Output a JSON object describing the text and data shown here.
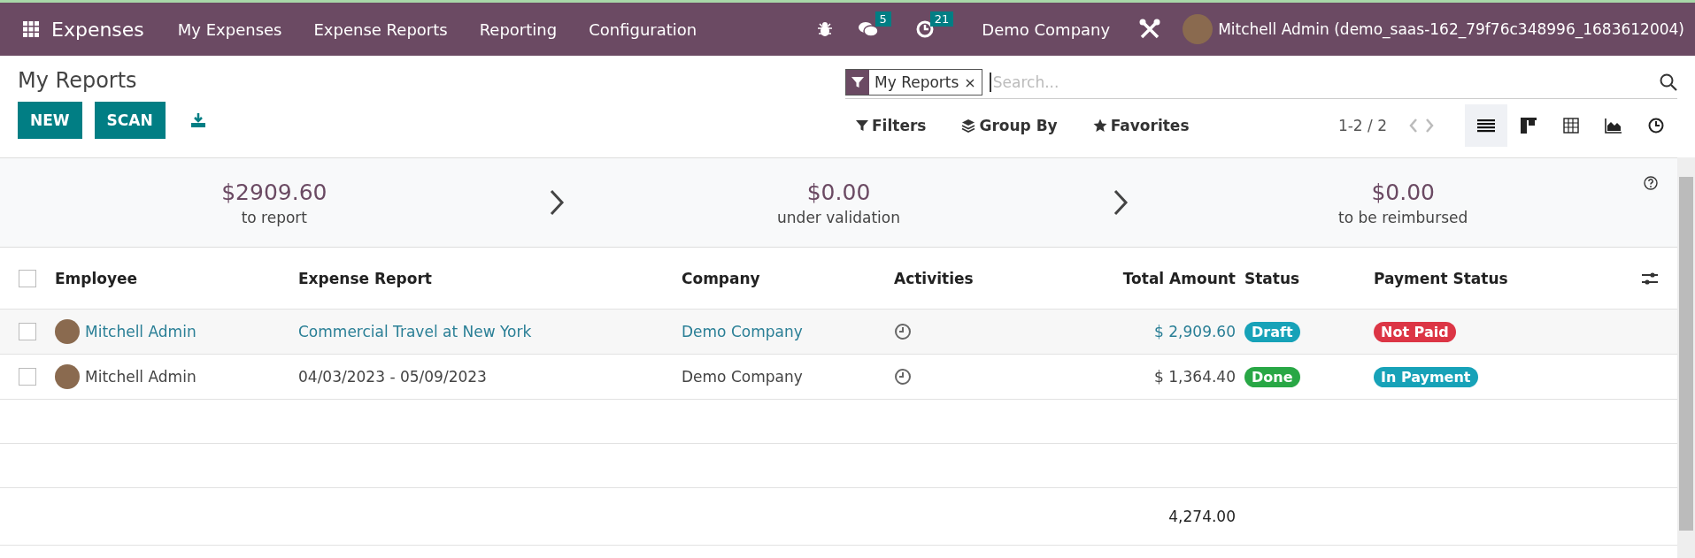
{
  "navbar": {
    "app_name": "Expenses",
    "menu": [
      "My Expenses",
      "Expense Reports",
      "Reporting",
      "Configuration"
    ],
    "messages_count": "5",
    "activities_count": "21",
    "company": "Demo Company",
    "user": "Mitchell Admin (demo_saas-162_79f76c348996_1683612004)"
  },
  "page": {
    "title": "My Reports",
    "buttons": [
      "NEW",
      "SCAN"
    ]
  },
  "search": {
    "facet": "My Reports",
    "facet_remove": "×",
    "placeholder": "Search..."
  },
  "filters": [
    "Filters",
    "Group By",
    "Favorites"
  ],
  "pager": "1-2 / 2",
  "views": [
    {
      "kind": "list",
      "selected": true
    },
    {
      "kind": "kanban",
      "selected": false
    },
    {
      "kind": "pivot",
      "selected": false
    },
    {
      "kind": "graph",
      "selected": false
    },
    {
      "kind": "activity",
      "selected": false
    }
  ],
  "summary": [
    {
      "amount": "$2909.60",
      "label": "to report"
    },
    {
      "amount": "$0.00",
      "label": "under validation"
    },
    {
      "amount": "$0.00",
      "label": "to be reimbursed"
    }
  ],
  "table": {
    "select_all_checked": false,
    "columns": [
      "Employee",
      "Expense Report",
      "Company",
      "Activities",
      "Total Amount",
      "Status",
      "Payment Status"
    ],
    "rows": [
      {
        "employee": "Mitchell Admin",
        "report": "Commercial Travel at New York",
        "company": "Demo Company",
        "total": "$ 2,909.60",
        "status": {
          "label": "Draft",
          "color": "#17a2b8"
        },
        "payment_status": {
          "label": "Not Paid",
          "color": "#dc3545"
        },
        "hovered": true,
        "checked": false
      },
      {
        "employee": "Mitchell Admin",
        "report": "04/03/2023 - 05/09/2023",
        "company": "Demo Company",
        "total": "$ 1,364.40",
        "status": {
          "label": "Done",
          "color": "#28a745"
        },
        "payment_status": {
          "label": "In Payment",
          "color": "#17a2b8"
        },
        "hovered": false,
        "checked": false
      }
    ],
    "footer_total": "4,274.00"
  }
}
